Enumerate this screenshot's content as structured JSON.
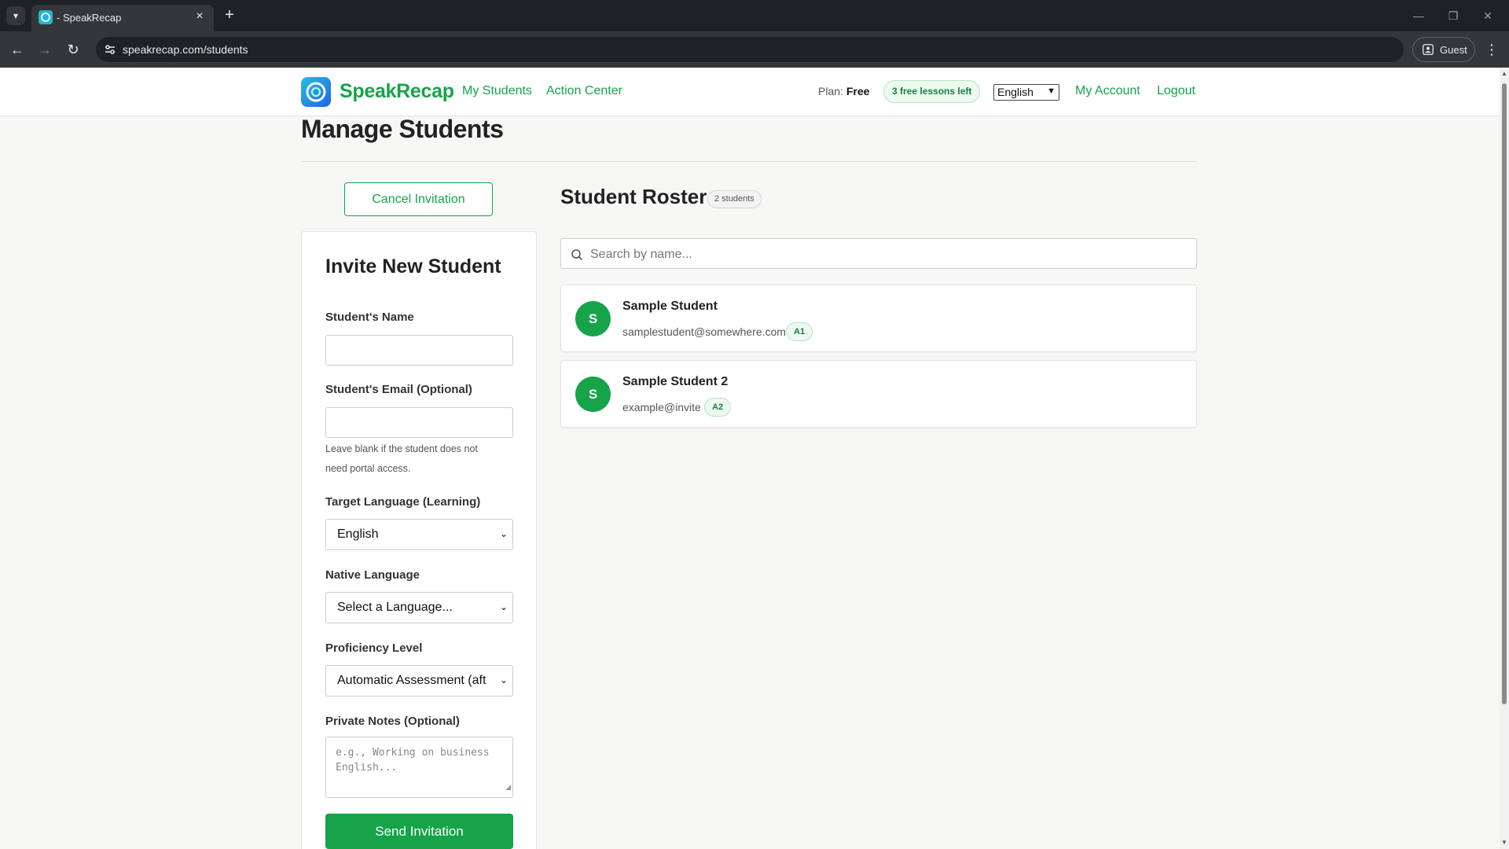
{
  "browser": {
    "tab_title": "- SpeakRecap",
    "url": "speakrecap.com/students",
    "profile_label": "Guest"
  },
  "header": {
    "logo_text": "SpeakRecap",
    "nav": [
      "My Students",
      "Action Center"
    ],
    "plan_label": "Plan:",
    "plan_value": "Free",
    "lessons_left": "3 free lessons left",
    "language": "English",
    "my_account": "My Account",
    "logout": "Logout"
  },
  "page": {
    "title": "Manage Students",
    "cancel_invitation": "Cancel Invitation"
  },
  "invite_form": {
    "title": "Invite New Student",
    "name_label": "Student's Name",
    "email_label": "Student's Email (Optional)",
    "email_help": "Leave blank if the student does not need portal access.",
    "target_language_label": "Target Language (Learning)",
    "target_language_value": "English",
    "native_language_label": "Native Language",
    "native_language_value": "Select a Language...",
    "proficiency_label": "Proficiency Level",
    "proficiency_value": "Automatic Assessment (aft",
    "notes_label": "Private Notes (Optional)",
    "notes_placeholder": "e.g., Working on business English...",
    "send_button": "Send Invitation"
  },
  "roster": {
    "title": "Student Roster",
    "count": "2 students",
    "search_placeholder": "Search by name...",
    "students": [
      {
        "initial": "S",
        "name": "Sample Student",
        "email": "samplestudent@somewhere.com",
        "level": "A1"
      },
      {
        "initial": "S",
        "name": "Sample Student 2",
        "email": "example@invite",
        "level": "A2"
      }
    ]
  },
  "colors": {
    "brand_green": "#16a34a",
    "pill_bg": "#ecfaf0",
    "chrome_dark": "#202124"
  }
}
